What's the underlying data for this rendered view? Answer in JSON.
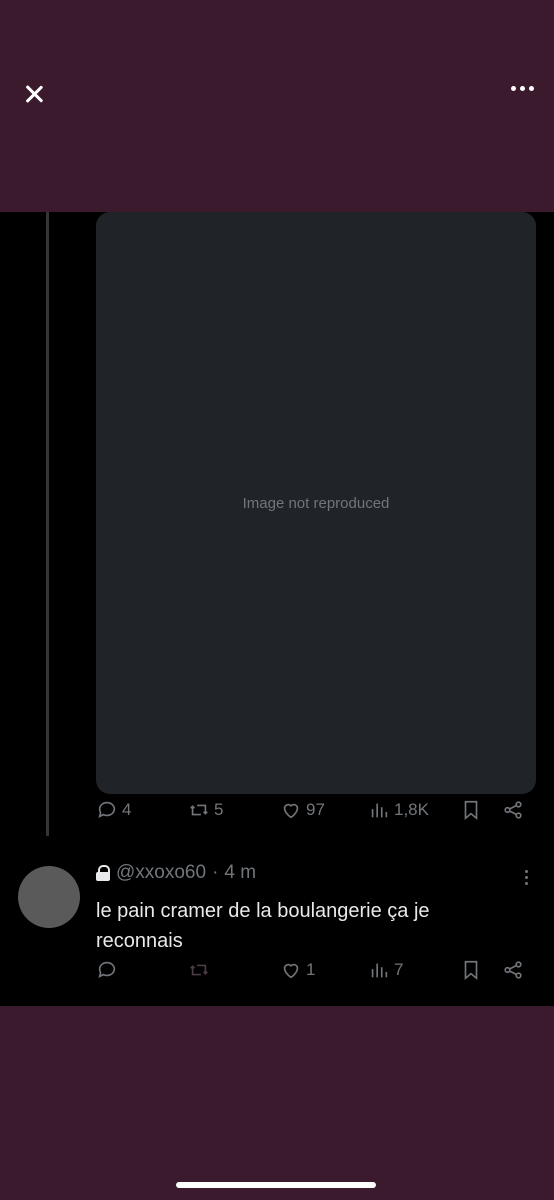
{
  "main_tweet": {
    "media": {
      "placeholder": "Image not reproduced"
    },
    "actions": {
      "replies": "4",
      "retweets": "5",
      "likes": "97",
      "views": "1,8K"
    }
  },
  "reply": {
    "handle": "@xxoxo60",
    "separator": "·",
    "time": "4 m",
    "text": "le pain cramer de la boulangerie ça je reconnais",
    "actions": {
      "retweets": "",
      "likes": "1",
      "views": "7"
    }
  },
  "colors": {
    "background": "#3b1a2e",
    "panel": "#000000",
    "muted": "#71767b",
    "text": "#e7e9ea"
  }
}
